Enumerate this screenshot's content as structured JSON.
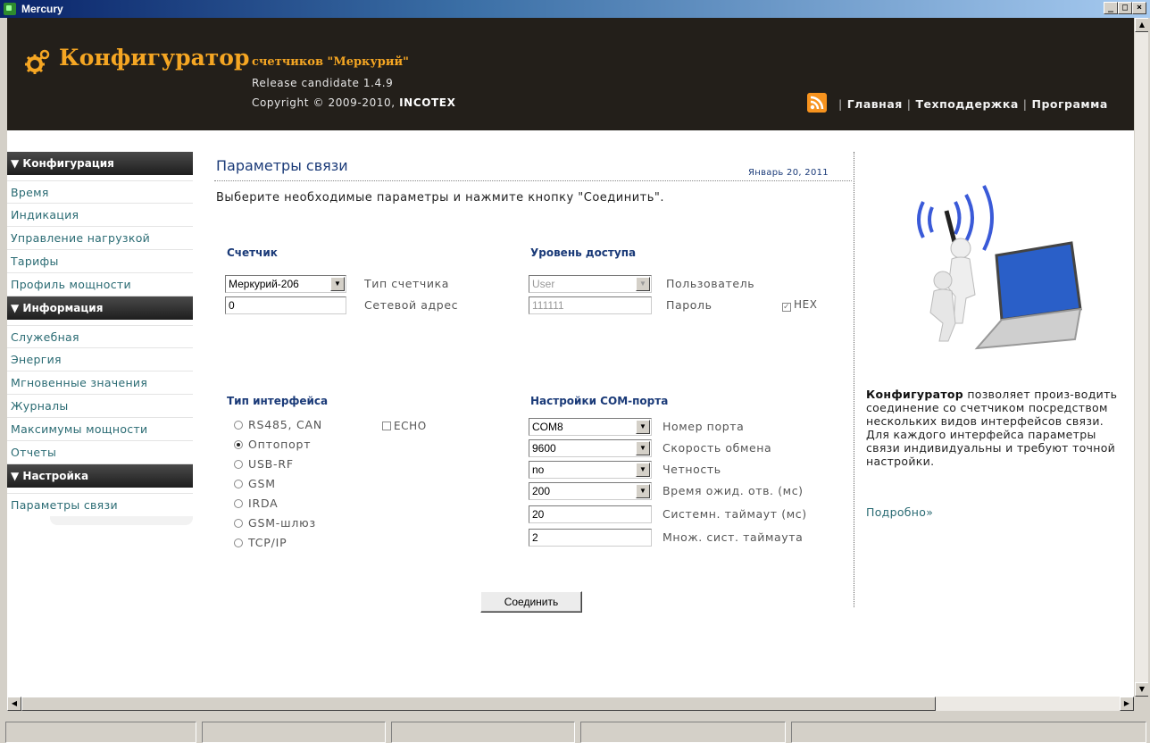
{
  "window": {
    "title": "Mercury"
  },
  "header": {
    "app_name": "Конфигуратор",
    "app_subtitle": "счетчиков \"Меркурий\"",
    "release": "Release candidate 1.4.9",
    "copyright_prefix": "Copyright © 2009-2010, ",
    "copyright_company": "INCOTEX",
    "nav": [
      "Главная",
      "Техподдержка",
      "Программа"
    ]
  },
  "sidebar": {
    "sections": [
      {
        "title": "▼ Конфигурация",
        "items": [
          "Время",
          "Индикация",
          "Управление нагрузкой",
          "Тарифы",
          "Профиль мощности"
        ]
      },
      {
        "title": "▼ Информация",
        "items": [
          "Служебная",
          "Энергия",
          "Мгновенные значения",
          "Журналы",
          "Максимумы мощности",
          "Отчеты"
        ]
      },
      {
        "title": "▼ Настройка",
        "items": [
          "Параметры связи"
        ]
      }
    ]
  },
  "page": {
    "title": "Параметры связи",
    "date": "Январь 20, 2011",
    "description": "Выберите необходимые параметры и нажмите кнопку \"Соединить\"."
  },
  "meter": {
    "section": "Счетчик",
    "type_value": "Меркурий-206",
    "type_label": "Тип счетчика",
    "address_value": "0",
    "address_label": "Сетевой адрес"
  },
  "access": {
    "section": "Уровень доступа",
    "level_value": "User",
    "level_label": "Пользователь",
    "password_value": "111111",
    "password_label": "Пароль",
    "hex_label": "HEX"
  },
  "interface": {
    "section": "Тип интерфейса",
    "echo_label": "ECHO",
    "options": [
      "RS485, CAN",
      "Оптопорт",
      "USB-RF",
      "GSM",
      "IRDA",
      "GSM-шлюз",
      "TCP/IP"
    ],
    "selected": "Оптопорт"
  },
  "com": {
    "section": "Настройки COM-порта",
    "port_value": "COM8",
    "port_label": "Номер порта",
    "speed_value": "9600",
    "speed_label": "Скорость обмена",
    "parity_value": "no",
    "parity_label": "Четность",
    "wait_value": "200",
    "wait_label": "Время ожид. отв. (мс)",
    "timeout_value": "20",
    "timeout_label": "Системн. таймаут (мс)",
    "mult_value": "2",
    "mult_label": "Множ. сист. таймаута"
  },
  "connect_label": "Соединить",
  "info": {
    "bold": "Конфигуратор",
    "text": " позволяет произ-водить соединение со счетчиком посредством нескольких видов интерфейсов связи. Для каждого интерфейса параметры связи индивидуальны и требуют точной настройки.",
    "more": "Подробно»"
  },
  "colors": {
    "header_bg": "#231f1a",
    "accent": "#f5a623",
    "link": "#2a6b73",
    "heading": "#1a3a78"
  }
}
